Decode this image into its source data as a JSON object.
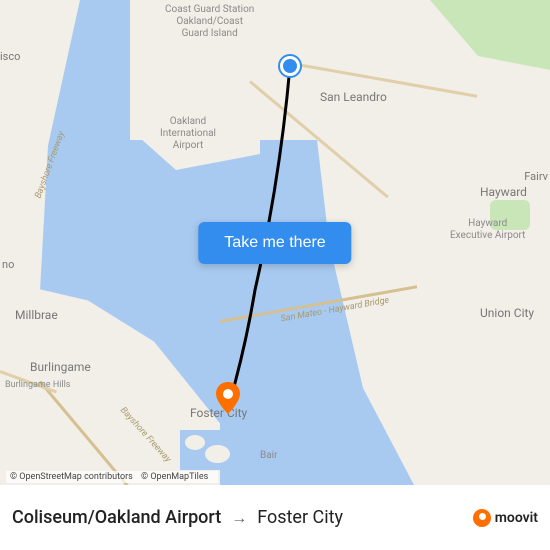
{
  "cta": {
    "label": "Take me there"
  },
  "markers": {
    "start": {
      "color": "#338def"
    },
    "end": {
      "color": "#ff6f00"
    }
  },
  "map_labels": {
    "san_leandro": "San Leandro",
    "hayward": "Hayward",
    "union_city": "Union City",
    "burlingame": "Burlingame",
    "millbrae": "Millbrae",
    "foster_city": "Foster City",
    "francisco_partial": "isco",
    "no_partial": "no",
    "fairv_partial": "Fairv",
    "burlingame_hills": "Burlingame Hills",
    "oakland_airport": "Oakland\nInternational\nAirport",
    "hayward_airport": "Hayward\nExecutive Airport",
    "coast_guard": "Coast Guard Station\nOakland/Coast\nGuard Island",
    "bair_partial": "Bair",
    "bridge_label": "San Mateo - Hayward Bridge",
    "bayshore_freeway": "Bayshore Freeway",
    "bayshore_freeway2": "Bayshore Freeway"
  },
  "attribution": {
    "osm": "© OpenStreetMap contributors",
    "omt": "© OpenMapTiles"
  },
  "footer": {
    "origin": "Coliseum/Oakland Airport",
    "destination": "Foster City",
    "brand": "moovit"
  }
}
